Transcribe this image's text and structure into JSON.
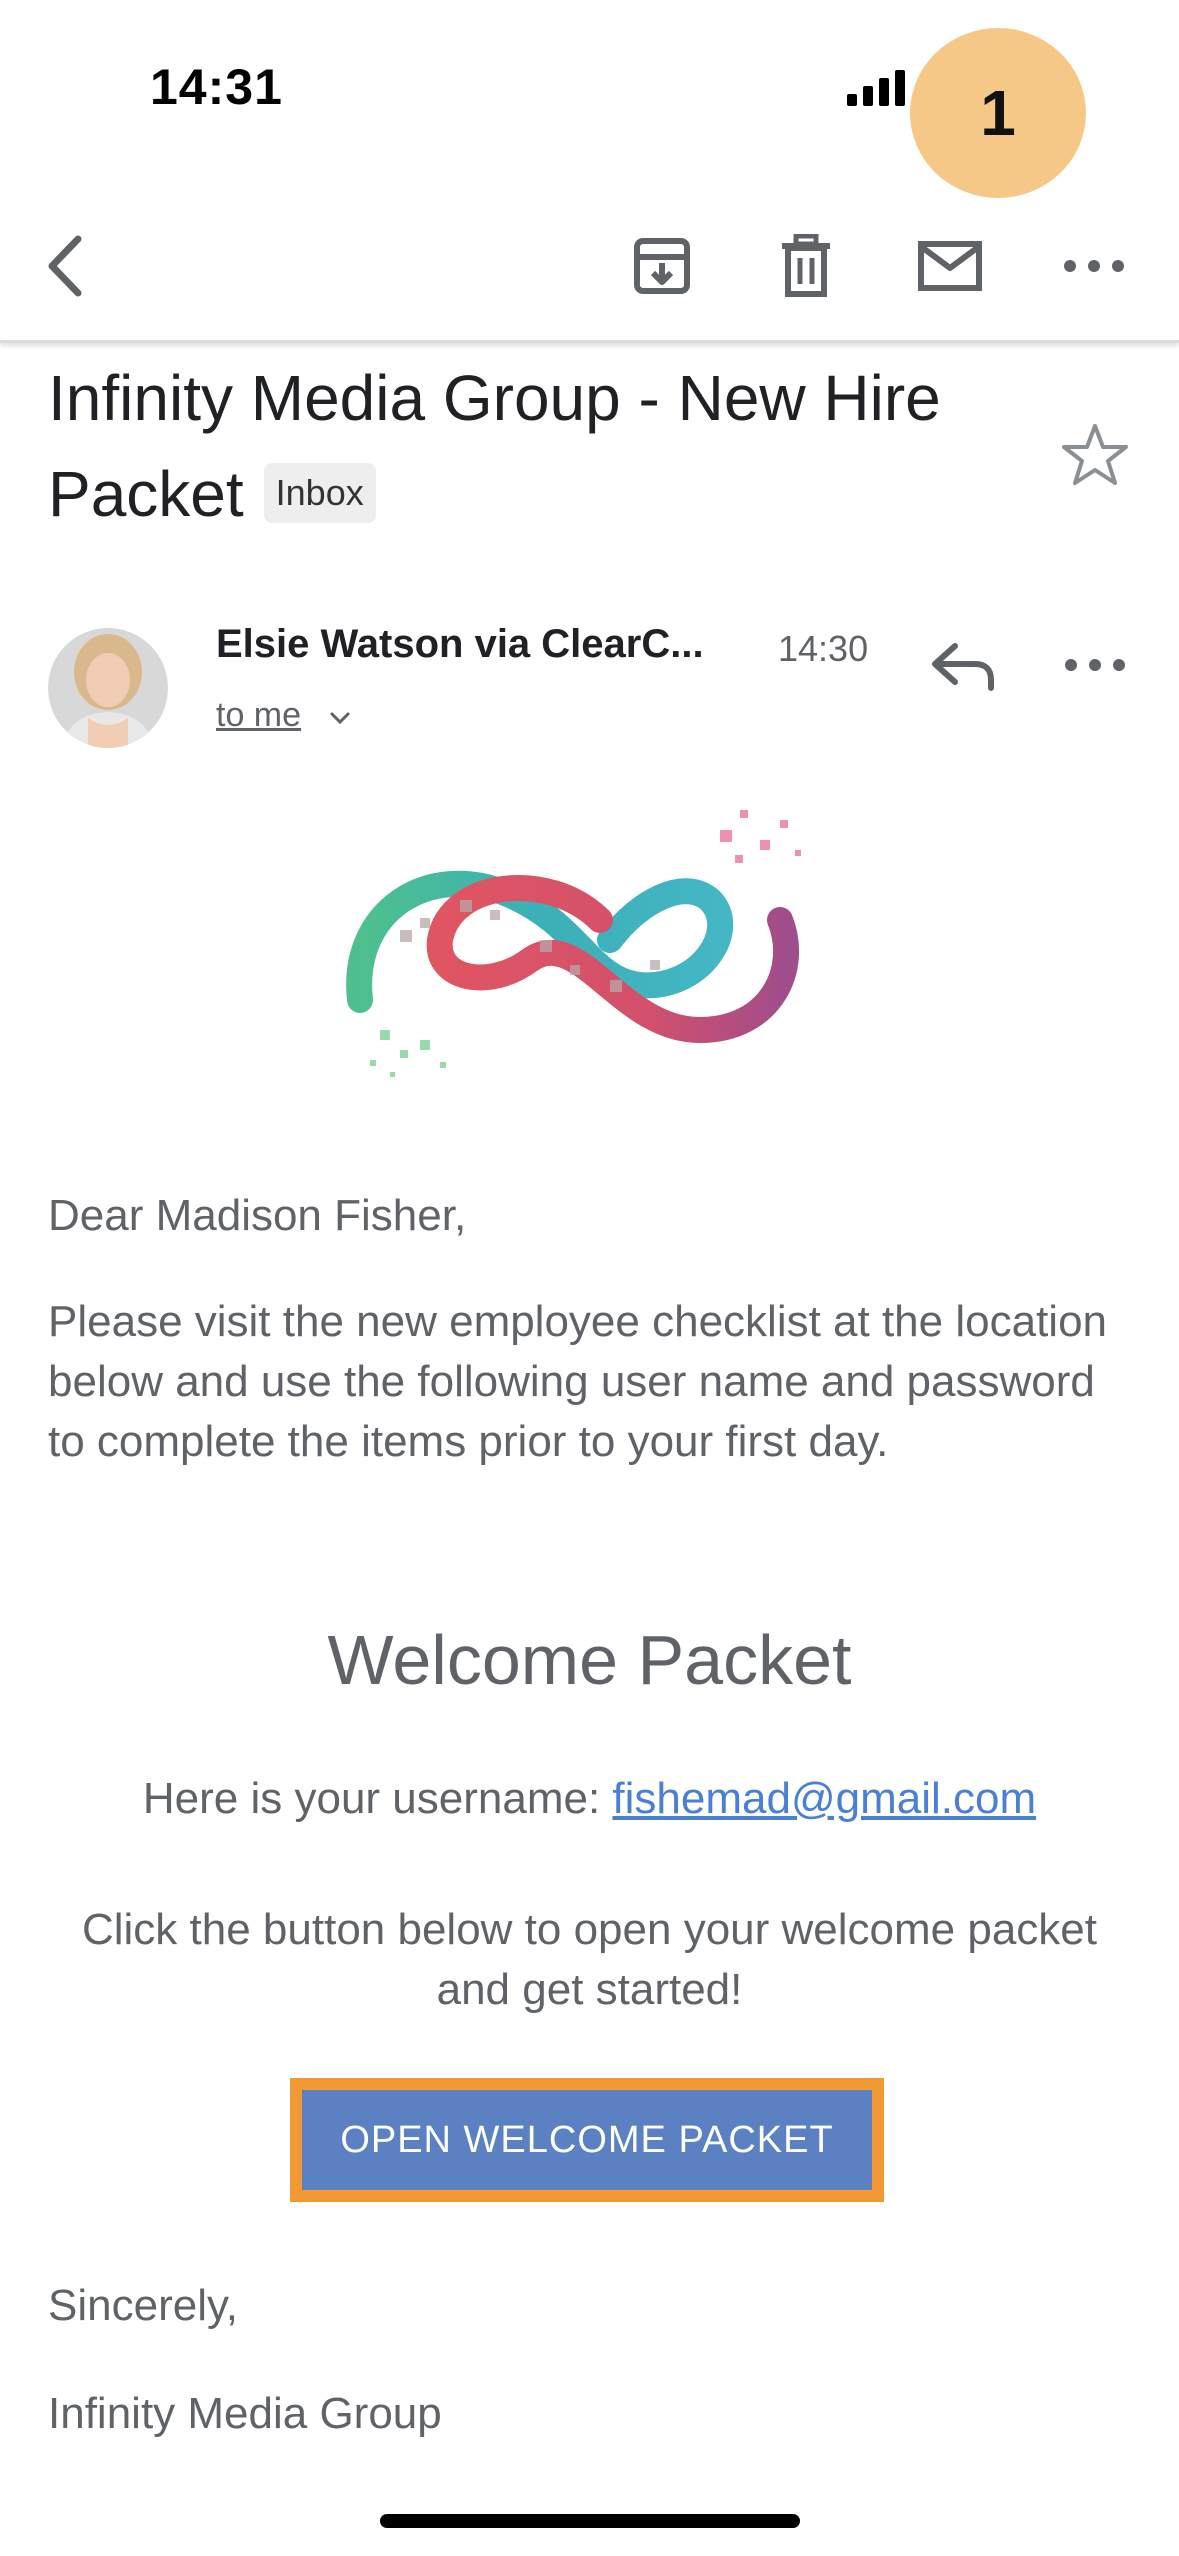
{
  "status_bar": {
    "time": "14:31",
    "badge": "1"
  },
  "toolbar": {
    "back": "back-arrow-icon",
    "archive": "archive-icon",
    "delete": "trash-icon",
    "mark_unread": "mail-icon",
    "more": "more-horizontal-icon"
  },
  "email": {
    "subject": "Infinity Media Group - New Hire Packet",
    "label": "Inbox",
    "sender": "Elsie Watson via ClearC...",
    "time": "14:30",
    "recipient": "to me",
    "greeting": "Dear Madison Fisher,",
    "intro": "Please visit the new employee checklist at the location below and use the following user name and password to complete the items prior to your first day.",
    "heading": "Welcome Packet",
    "username_prefix": "Here is your username: ",
    "username": "fishemad@gmail.com",
    "instructions": "Click the button below to open your welcome packet and get started!",
    "button_label": "OPEN WELCOME PACKET",
    "closing": "Sincerely,",
    "signature": "Infinity Media Group"
  },
  "colors": {
    "badge": "#f6c887",
    "button": "#5b81c2",
    "button_highlight": "#f19a35",
    "link": "#4a7fd6",
    "body_text": "#5f6368"
  }
}
